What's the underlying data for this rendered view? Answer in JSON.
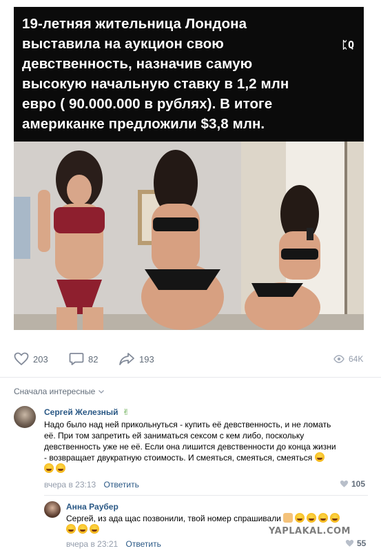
{
  "post": {
    "caption_lines": [
      "19-летняя жительница Лондона",
      "выставила на аукцион свою",
      "девственность, назначив самую",
      "высокую начальную ставку в 1,2 млн",
      "евро ( 90.000.000 в рублях). В итоге",
      "американке предложили $3,8 млн."
    ],
    "caption_logo": "ᛈQ"
  },
  "actions": {
    "likes": "203",
    "comments": "82",
    "shares": "193",
    "views": "64K"
  },
  "comments_header": {
    "sort_label": "Сначала интересные"
  },
  "comments": [
    {
      "author": "Сергей Железный",
      "text_lines": [
        "Надо было над ней прикольнуться - купить её девственность, и не ломать",
        "её. При том запретить ей заниматься сексом с кем либо, поскольку",
        "девственность уже не её. Если она лишится девственности до конца жизни",
        "- возвращает двукратную стоимость. И смеяться, смеяться, смеяться"
      ],
      "time": "вчера в 23:13",
      "reply_label": "Ответить",
      "likes": "105"
    },
    {
      "author": "Анна Раубер",
      "text_lines": [
        "Сергей, из ада щас позвонили, твой номер спрашивали"
      ],
      "time": "вчера в 23:21",
      "reply_label": "Ответить",
      "likes": "55"
    }
  ],
  "watermark": "YAPLAKAL.COM",
  "colors": {
    "link": "#2a5885",
    "meta": "#939cab",
    "action": "#626d7a",
    "caption_bg": "#0b0b0b"
  },
  "icons": [
    "heart-icon",
    "comment-icon",
    "share-icon",
    "eye-icon",
    "chevron-down-icon",
    "like-heart-icon"
  ]
}
